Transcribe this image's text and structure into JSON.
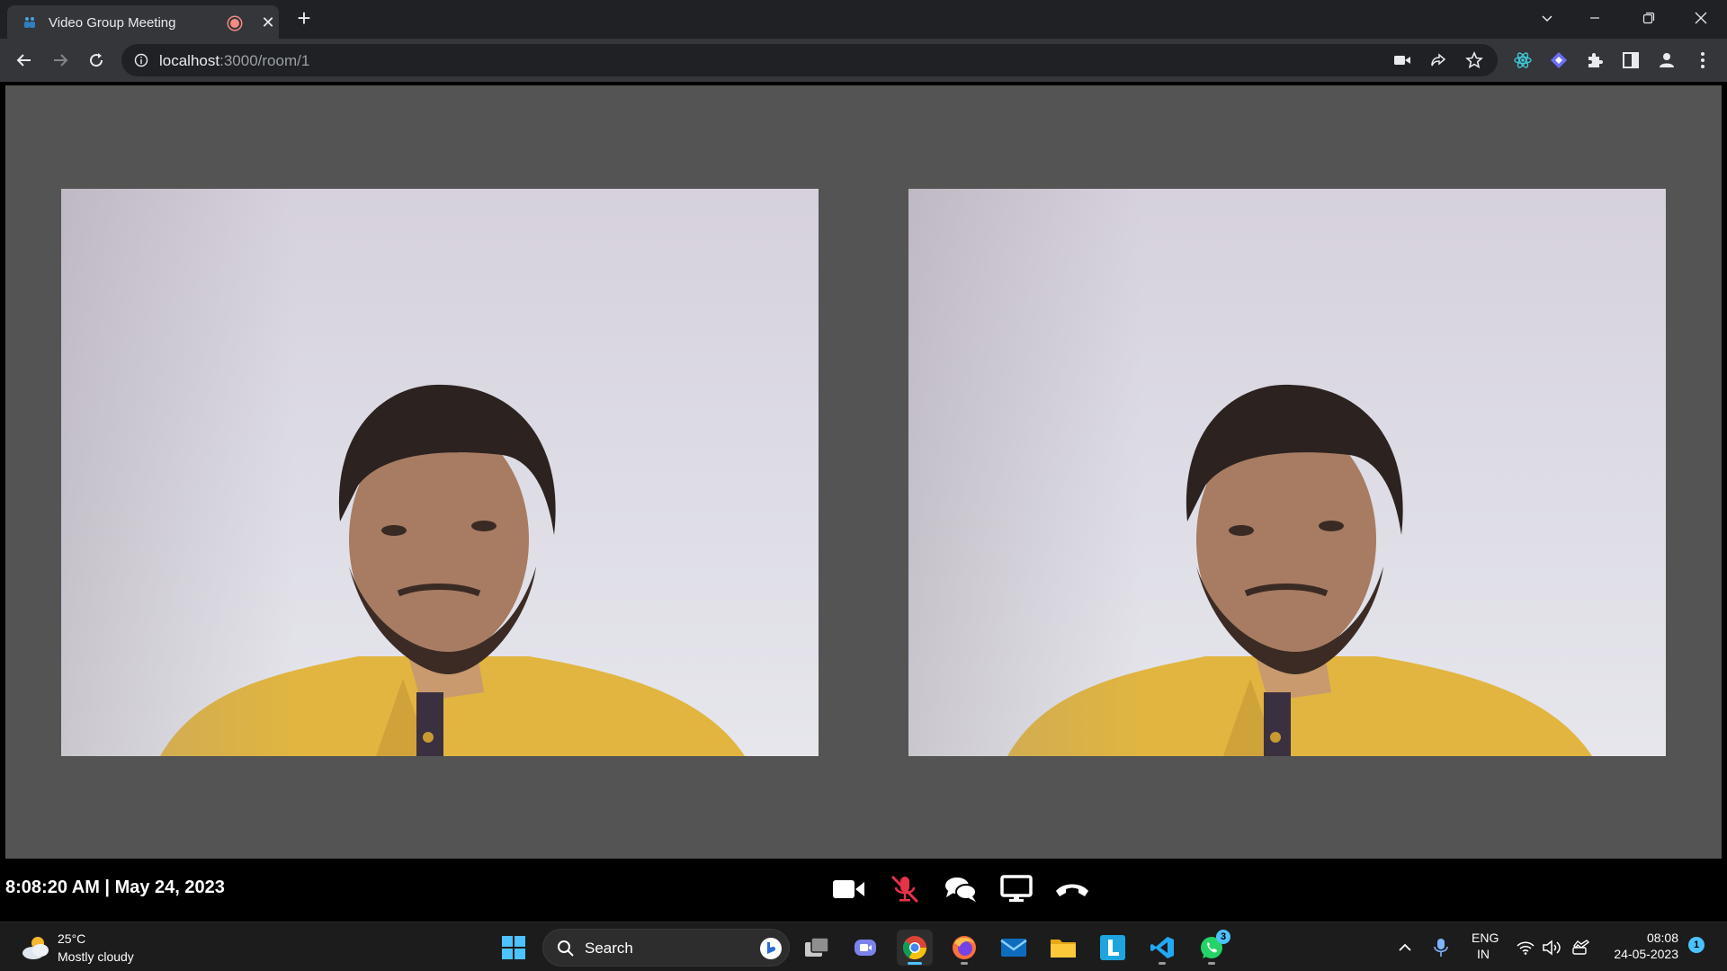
{
  "browser": {
    "tab": {
      "title": "Video Group Meeting"
    },
    "url": {
      "host": "localhost",
      "path": ":3000/room/1"
    }
  },
  "meeting": {
    "videos": [
      {
        "alt": "participant-video-1"
      },
      {
        "alt": "participant-video-2"
      }
    ],
    "datetime": "8:08:20 AM | May 24, 2023",
    "controls": [
      {
        "name": "camera-toggle",
        "icon": "video-camera-icon"
      },
      {
        "name": "mic-toggle",
        "icon": "microphone-muted-icon",
        "color": "#e8324a"
      },
      {
        "name": "chat",
        "icon": "chat-bubbles-icon"
      },
      {
        "name": "screen-share",
        "icon": "monitor-icon"
      },
      {
        "name": "leave-call",
        "icon": "phone-hangup-icon"
      }
    ]
  },
  "taskbar": {
    "weather": {
      "temp": "25°C",
      "condition": "Mostly cloudy"
    },
    "search_label": "Search",
    "whatsapp_badge": "3",
    "language": {
      "line1": "ENG",
      "line2": "IN"
    },
    "time": "08:08",
    "date": "24-05-2023",
    "notifications": "1"
  },
  "colors": {
    "stage": "#545454",
    "tab": "#35363a",
    "accent": "#4cc2ff"
  }
}
